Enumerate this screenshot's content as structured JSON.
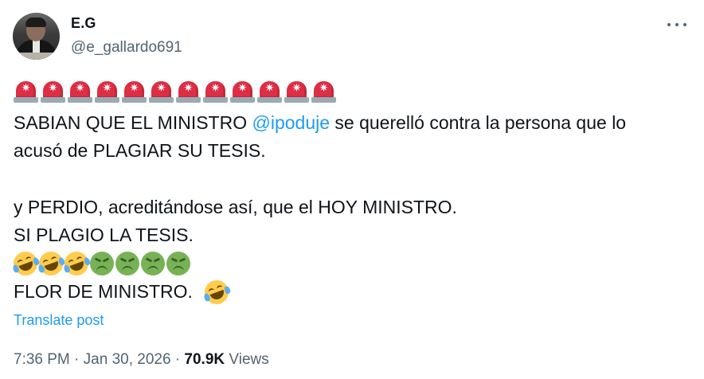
{
  "author": {
    "name": "E.G",
    "handle": "@e_gallardo691"
  },
  "icons": {
    "siren": "police-car-light-icon",
    "laugh": "rolling-on-the-floor-laughing-icon",
    "sick": "nauseated-face-icon",
    "more": "more-options-icon"
  },
  "siren_count": 12,
  "tweet": {
    "line1_before": "SABIAN QUE EL MINISTRO ",
    "mention": "@ipoduje",
    "line1_after": " se querelló contra la persona que lo",
    "line2": "acusó de PLAGIAR SU TESIS.",
    "line3": "y PERDIO, acreditándose así, que el HOY  MINISTRO.",
    "line4": "SI PLAGIO LA TESIS.",
    "emoji_row": [
      "laugh",
      "laugh",
      "laugh",
      "sick",
      "sick",
      "sick",
      "sick"
    ],
    "line5": "FLOR DE MINISTRO."
  },
  "translate_label": "Translate post",
  "meta": {
    "time": "7:36 PM",
    "separator": " · ",
    "date": "Jan 30, 2026",
    "views_count": "70.9K",
    "views_label": " Views"
  },
  "colors": {
    "link": "#1d9bf0",
    "secondary_text": "#536471",
    "primary_text": "#0f1419"
  }
}
